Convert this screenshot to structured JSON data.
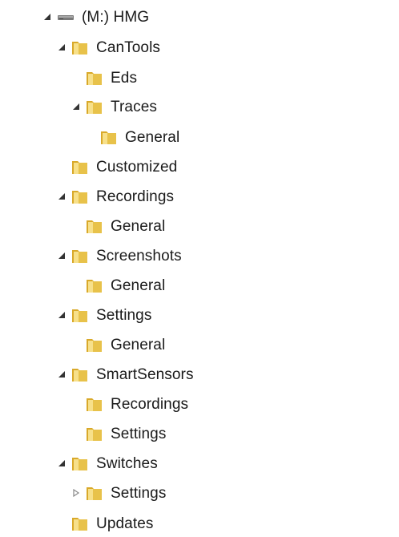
{
  "tree": {
    "drive": {
      "label": "(M:) HMG"
    },
    "cantools": {
      "label": "CanTools"
    },
    "eds": {
      "label": "Eds"
    },
    "traces": {
      "label": "Traces"
    },
    "traces_general": {
      "label": "General"
    },
    "customized": {
      "label": "Customized"
    },
    "recordings": {
      "label": "Recordings"
    },
    "recordings_general": {
      "label": "General"
    },
    "screenshots": {
      "label": "Screenshots"
    },
    "screenshots_general": {
      "label": "General"
    },
    "settings": {
      "label": "Settings"
    },
    "settings_general": {
      "label": "General"
    },
    "smartsensors": {
      "label": "SmartSensors"
    },
    "smartsensors_recordings": {
      "label": "Recordings"
    },
    "smartsensors_settings": {
      "label": "Settings"
    },
    "switches": {
      "label": "Switches"
    },
    "switches_settings": {
      "label": "Settings"
    },
    "updates": {
      "label": "Updates"
    }
  },
  "icons": {
    "expanded": "expanded-arrow-icon",
    "collapsed": "collapsed-arrow-icon",
    "folder": "folder-icon",
    "drive": "drive-icon"
  },
  "colors": {
    "folder_body": "#e8c24a",
    "folder_light": "#f7e08a",
    "arrow_expanded": "#333333",
    "arrow_collapsed": "#8a8a8a"
  }
}
